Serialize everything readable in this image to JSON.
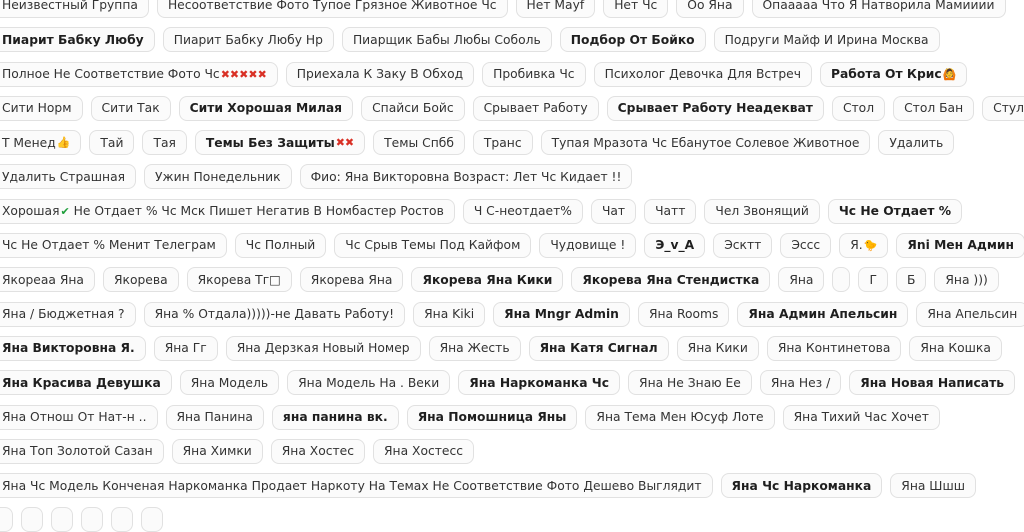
{
  "colors": {
    "tag_bg": "#fbfbfb",
    "tag_border": "#e1e1e1",
    "text": "#333333"
  },
  "rows": [
    [
      {
        "label": "Неизвестный Группа"
      },
      {
        "label": "Несоответствие Фото Тупое Грязное Животное Чс"
      },
      {
        "label": "Нет Mayf"
      },
      {
        "label": "Нет Чс"
      },
      {
        "label": "Оо Яна"
      },
      {
        "label": "Опааааа Что Я Натворила Мамииии"
      }
    ],
    [
      {
        "label": "Пиарит Бабку Любу",
        "bold": true
      },
      {
        "label": "Пиарит Бабку Любу Нр"
      },
      {
        "label": "Пиарщик Бабы Любы Соболь"
      },
      {
        "label": "Подбор От Бойко",
        "bold": true
      },
      {
        "label": "Подруги Майф И Ирина Москва"
      }
    ],
    [
      {
        "label": "Полное Не Соответствие Фото Чс",
        "emoji": "✖✖✖✖✖",
        "emoji_icon": "cross-mark-icon"
      },
      {
        "label": "Приехала К Заку В Обход"
      },
      {
        "label": "Пробивка Чс"
      },
      {
        "label": "Психолог Девочка Для Встреч"
      },
      {
        "label": "Работа От Крис",
        "bold": true,
        "emoji": "🙆",
        "emoji_icon": "person-icon"
      }
    ],
    [
      {
        "label": "Сити Норм"
      },
      {
        "label": "Сити Так"
      },
      {
        "label": "Сити Хорошая Милая",
        "bold": true
      },
      {
        "label": "Спайси Бойс"
      },
      {
        "label": "Срывает Работу"
      },
      {
        "label": "Срывает Работу Неадекват",
        "bold": true
      },
      {
        "label": "Стол"
      },
      {
        "label": "Стол Бан"
      },
      {
        "label": "Стул",
        "emoji": "❤",
        "emoji_icon": "heart-icon"
      }
    ],
    [
      {
        "label": "Т Менед",
        "emoji": "👍",
        "emoji_icon": "thumbs-up-icon"
      },
      {
        "label": "Тай"
      },
      {
        "label": "Тая"
      },
      {
        "label": "Темы Без Защиты",
        "bold": true,
        "emoji": "✖✖",
        "emoji_icon": "cross-mark-icon"
      },
      {
        "label": "Темы Спбб"
      },
      {
        "label": "Транс"
      },
      {
        "label": "Тупая Мразота Чс Ебанутое Солевое Животное"
      },
      {
        "label": "Удалить"
      }
    ],
    [
      {
        "label": "Удалить Страшная"
      },
      {
        "label": "Ужин Понедельник"
      },
      {
        "label": "Фио: Яна Викторовна Возраст: Лет Чс Кидает !!"
      }
    ],
    [
      {
        "label": "Хорошая",
        "emoji": "✔",
        "emoji_icon": "check-mark-icon",
        "suffix": " Не Отдает % Чс Мск Пишет Негатив В Номбастер Ростов"
      },
      {
        "label": "Ч С-неотдает%"
      },
      {
        "label": "Чат"
      },
      {
        "label": "Чатт"
      },
      {
        "label": "Чел Звонящий"
      },
      {
        "label": "Чс Не Отдает %",
        "bold": true
      }
    ],
    [
      {
        "label": "Чс Не Отдает % Менит Телеграм"
      },
      {
        "label": "Чс Полный"
      },
      {
        "label": "Чс Срыв Темы Под Кайфом"
      },
      {
        "label": "Чудовище !"
      },
      {
        "label": "Э_v_A",
        "bold": true
      },
      {
        "label": "Эсктт"
      },
      {
        "label": "Эссс"
      },
      {
        "label": "Я.",
        "emoji": "🐤",
        "emoji_icon": "chick-icon"
      },
      {
        "label": "Яni Мен Админ",
        "bold": true
      }
    ],
    [
      {
        "label": "Якореаа Яна"
      },
      {
        "label": "Якорева"
      },
      {
        "label": "Якорева Тг□"
      },
      {
        "label": "Якорева Яна"
      },
      {
        "label": "Якорева Яна Кики",
        "bold": true
      },
      {
        "label": "Якорева Яна Стендистка",
        "bold": true
      },
      {
        "label": "Яна"
      },
      {
        "label": "",
        "empty": true
      },
      {
        "label": "Г"
      },
      {
        "label": "Б"
      },
      {
        "label": "Яна )))"
      }
    ],
    [
      {
        "label": "Яна / Бюджетная ?"
      },
      {
        "label": "Яна % Отдала)))))-не Давать Работу!"
      },
      {
        "label": "Яна Kiki"
      },
      {
        "label": "Яна Mngr Admin",
        "bold": true
      },
      {
        "label": "Яна Rooms"
      },
      {
        "label": "Яна Админ Апельсин",
        "bold": true
      },
      {
        "label": "Яна Апельсин"
      }
    ],
    [
      {
        "label": "Яна Викторовна Я.",
        "bold": true
      },
      {
        "label": "Яна Гг"
      },
      {
        "label": "Яна Дерзкая Новый Номер"
      },
      {
        "label": "Яна Жесть"
      },
      {
        "label": "Яна Катя Сигнал",
        "bold": true
      },
      {
        "label": "Яна Кики"
      },
      {
        "label": "Яна Континетова"
      },
      {
        "label": "Яна Кошка"
      }
    ],
    [
      {
        "label": "Яна Красива Девушка",
        "bold": true
      },
      {
        "label": "Яна Модель"
      },
      {
        "label": "Яна Модель На . Веки"
      },
      {
        "label": "Яна Наркоманка Чс",
        "bold": true
      },
      {
        "label": "Яна Не Знаю Ее"
      },
      {
        "label": "Яна Нез /"
      },
      {
        "label": "Яна Новая Написать",
        "bold": true
      }
    ],
    [
      {
        "label": "Яна Отнош От Нат-н .."
      },
      {
        "label": "Яна Панина"
      },
      {
        "label": "яна панина вк.",
        "bold": true
      },
      {
        "label": "Яна Помошница Яны",
        "bold": true
      },
      {
        "label": "Яна Тема Мен Юсуф Лоте"
      },
      {
        "label": "Яна Тихий Час Хочет"
      }
    ],
    [
      {
        "label": "Яна Топ Золотой Сазан"
      },
      {
        "label": "Яна Химки"
      },
      {
        "label": "Яна Хостес"
      },
      {
        "label": "Яна Хостесс"
      }
    ],
    [
      {
        "label": "Яна Чс Модель Конченая Наркоманка Продает Наркоту На Темах Не Соответствие Фото Дешево Выглядит"
      },
      {
        "label": "Яна Чс Наркоманка",
        "bold": true
      },
      {
        "label": "Яна Шшш"
      }
    ],
    [
      {
        "label": ""
      },
      {
        "label": ""
      },
      {
        "label": ""
      },
      {
        "label": ""
      },
      {
        "label": ""
      },
      {
        "label": ""
      }
    ]
  ]
}
